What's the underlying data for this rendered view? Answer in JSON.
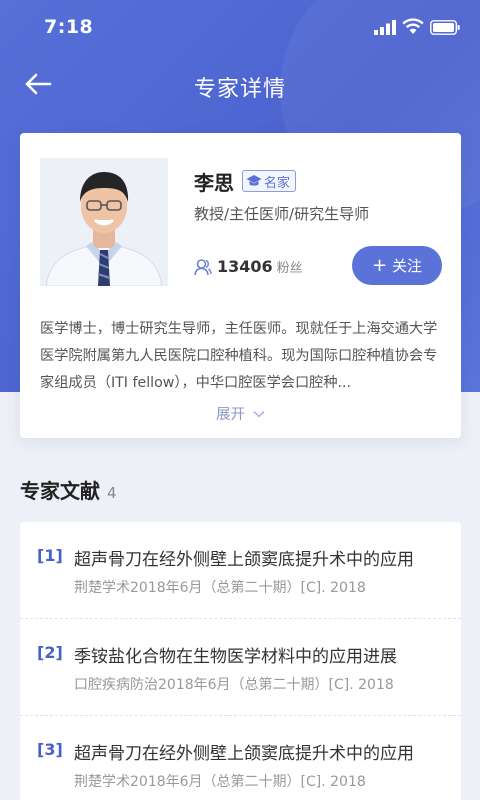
{
  "status_bar": {
    "time": "7:18"
  },
  "nav": {
    "title": "专家详情"
  },
  "profile": {
    "name": "李思",
    "badge": "名家",
    "title": "教授/主任医师/研究生导师",
    "fans_count": "13406",
    "fans_label": "粉丝",
    "follow_label": "关注",
    "bio": "医学博士，博士研究生导师，主任医师。现就任于上海交通大学医学院附属第九人民医院口腔种植科。现为国际口腔种植协会专家组成员（ITI fellow），中华口腔医学会口腔种...",
    "expand_label": "展开"
  },
  "papers_section": {
    "title": "专家文献",
    "count": "4",
    "items": [
      {
        "index": "[1]",
        "title": "超声骨刀在经外侧壁上颌窦底提升术中的应用",
        "source": "荆楚学术2018年6月（总第二十期）[C]. 2018"
      },
      {
        "index": "[2]",
        "title": "季铵盐化合物在生物医学材料中的应用进展",
        "source": "口腔疾病防治2018年6月（总第二十期）[C]. 2018"
      },
      {
        "index": "[3]",
        "title": "超声骨刀在经外侧壁上颌窦底提升术中的应用",
        "source": "荆楚学术2018年6月（总第二十期）[C]. 2018"
      }
    ]
  },
  "colors": {
    "brand": "#5b72d9",
    "hero": "#4f67d2"
  }
}
